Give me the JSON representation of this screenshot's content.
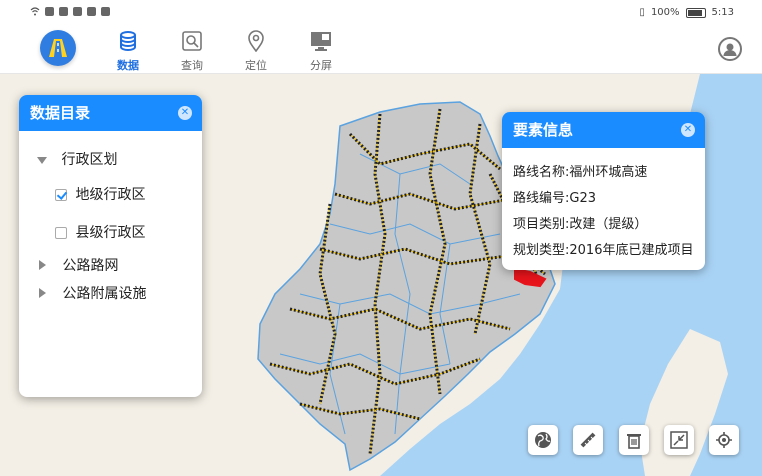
{
  "status_bar": {
    "battery": "100%",
    "time": "5:13"
  },
  "nav_tabs": [
    {
      "label": "数据",
      "icon": "database-icon"
    },
    {
      "label": "查询",
      "icon": "search-icon"
    },
    {
      "label": "定位",
      "icon": "location-pin-icon"
    },
    {
      "label": "分屏",
      "icon": "split-screen-icon"
    }
  ],
  "catalog": {
    "title": "数据目录",
    "tree": [
      {
        "label": "行政区划",
        "state": "expanded"
      },
      {
        "label": "地级行政区",
        "checked": true
      },
      {
        "label": "县级行政区",
        "checked": false
      },
      {
        "label": "公路路网",
        "state": "collapsed"
      },
      {
        "label": "公路附属设施",
        "state": "collapsed"
      }
    ]
  },
  "info": {
    "title": "要素信息",
    "rows": [
      "路线名称:福州环城高速",
      "路线编号:G23",
      "项目类别:改建（提级）",
      "规划类型:2016年底已建成项目"
    ]
  },
  "tools": [
    {
      "icon": "globe-icon"
    },
    {
      "icon": "ruler-icon"
    },
    {
      "icon": "trash-icon"
    },
    {
      "icon": "collapse-icon"
    },
    {
      "icon": "locate-icon"
    }
  ],
  "colors": {
    "accent": "#1a8cff",
    "highlight_route": "#e8141c",
    "road_network": "#f2c200"
  }
}
